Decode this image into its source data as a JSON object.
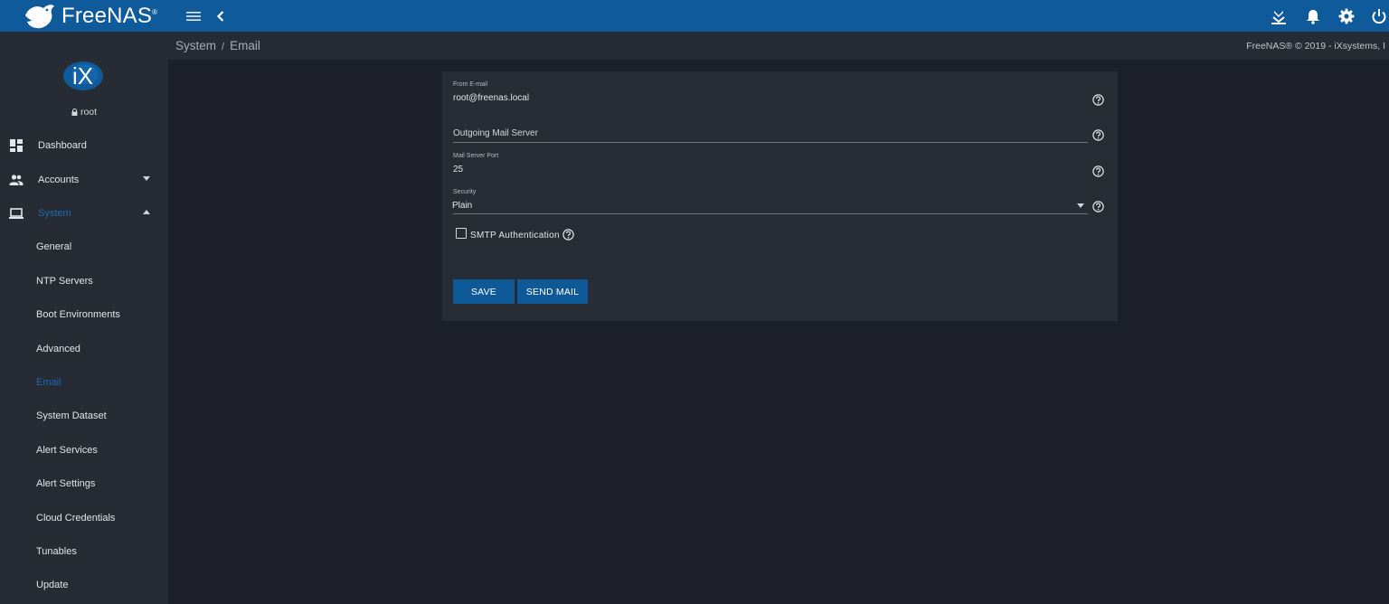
{
  "topbar": {
    "brand": "FreeNAS",
    "brand_tm": "®",
    "icons": [
      "freenas-bird-logo-icon",
      "menu-icon",
      "chevron-left-icon",
      "update-download-icon",
      "bell-icon",
      "gear-icon",
      "power-icon"
    ]
  },
  "breadcrumb": {
    "parent": "System",
    "separator": "/",
    "current": "Email"
  },
  "copyright": "FreeNAS® © 2019 - iXsystems, I",
  "sidebar": {
    "user": "root",
    "nav": [
      {
        "label": "Dashboard",
        "icon": "dashboard-icon"
      },
      {
        "label": "Accounts",
        "icon": "people-icon"
      },
      {
        "label": "System",
        "icon": "laptop-icon"
      }
    ],
    "system_items": [
      "General",
      "NTP Servers",
      "Boot Environments",
      "Advanced",
      "Email",
      "System Dataset",
      "Alert Services",
      "Alert Settings",
      "Cloud Credentials",
      "Tunables",
      "Update"
    ],
    "active_item": "Email"
  },
  "form": {
    "from_email_label": "From E-mail",
    "from_email_value": "root@freenas.local",
    "outgoing_server_placeholder": "Outgoing Mail Server",
    "port_label": "Mail Server Port",
    "port_value": "25",
    "security_label": "Security",
    "security_value": "Plain",
    "smtp_auth_label": "SMTP Authentication",
    "smtp_auth_checked": false,
    "save_label": "SAVE",
    "send_mail_label": "SEND MAIL"
  },
  "colors": {
    "topbar": "#0f5a9a",
    "accent": "#1b6cb4",
    "button": "#0e5a98",
    "background": "#1d2029",
    "panel": "#272b34"
  }
}
